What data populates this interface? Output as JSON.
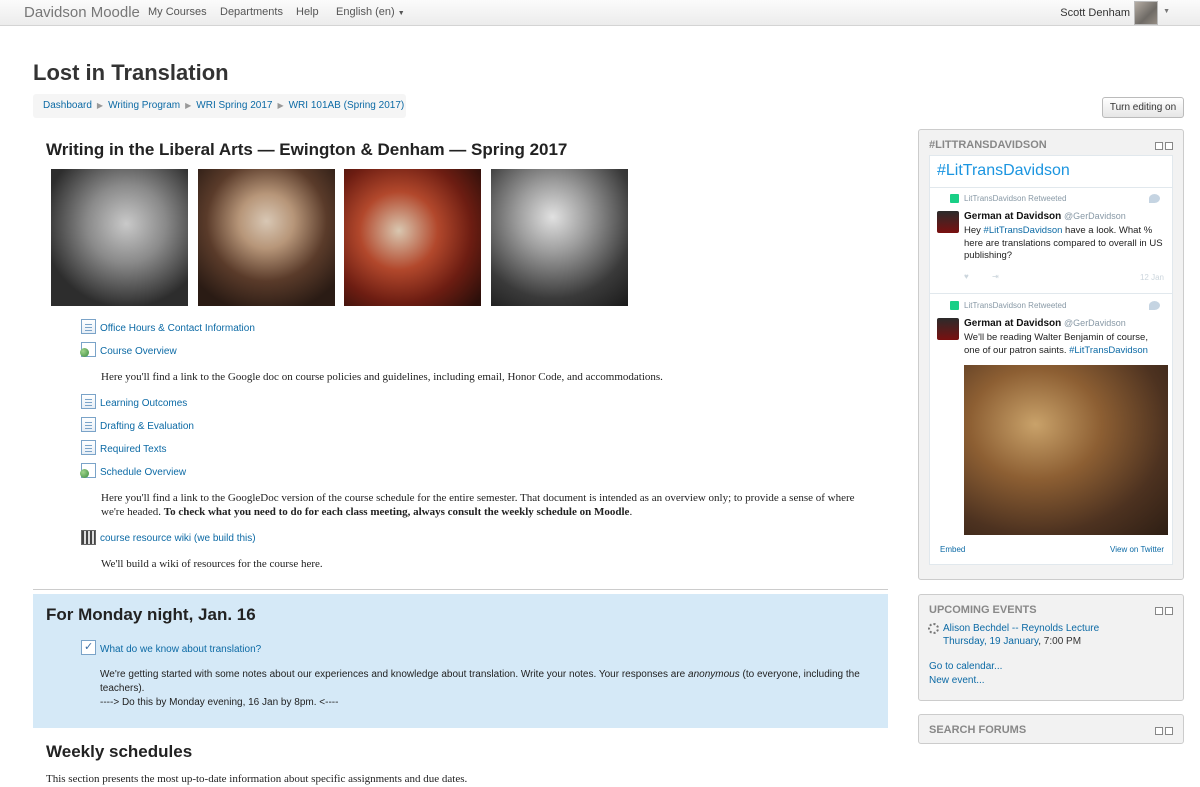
{
  "navbar": {
    "brand": "Davidson Moodle",
    "items": [
      "My Courses",
      "Departments",
      "Help",
      "English (en)"
    ],
    "user_name": "Scott Denham"
  },
  "header": {
    "title": "Lost in Translation",
    "breadcrumb": [
      "Dashboard",
      "Writing Program",
      "WRI Spring 2017",
      "WRI 101AB (Spring 2017)"
    ],
    "edit_button": "Turn editing on"
  },
  "section1": {
    "title": "Writing in the Liberal Arts — Ewington & Denham — Spring 2017",
    "activities": [
      {
        "label": "Office Hours & Contact Information",
        "icon": "document-icon"
      },
      {
        "label": "Course Overview",
        "icon": "url-icon",
        "description": "Here you'll find a link to the Google doc on course policies and guidelines, including email, Honor Code, and accommodations."
      },
      {
        "label": "Learning Outcomes",
        "icon": "document-icon"
      },
      {
        "label": "Drafting & Evaluation",
        "icon": "document-icon"
      },
      {
        "label": "Required Texts",
        "icon": "document-icon"
      },
      {
        "label": "Schedule Overview",
        "icon": "url-icon",
        "description_1": "Here you'll find a link to the GoogleDoc version of the course schedule for the entire semester. That document is intended as an overview only; to provide a sense of where",
        "description_2": "we're headed.",
        "description_bold": "To check what you need to do for each class meeting, always consult the weekly schedule on Moodle"
      },
      {
        "label": "course resource wiki (we build this)",
        "icon": "wiki-icon",
        "description": "We'll build a wiki of resources for the course here."
      }
    ]
  },
  "section2": {
    "title": "For Monday night, Jan. 16",
    "activity_label": "What do we know about translation?",
    "text_1_before": "We're getting started with some notes about our experiences and knowledge about translation. Write your notes. Your responses are",
    "text_1_em": "anonymous",
    "text_1_after": "(to everyone, including the",
    "text_2": "teachers).",
    "text_3": "----> Do this by Monday evening, 16 Jan by 8pm. <----"
  },
  "section3": {
    "title": "Weekly schedules",
    "text": "This section presents the most up-to-date information about specific assignments and due dates."
  },
  "sidebar": {
    "twitter": {
      "block_title": "#LITTRANSDAVIDSON",
      "heading": "#LitTransDavidson",
      "tweets": [
        {
          "retweet": "LitTransDavidson Retweeted",
          "name": "German at Davidson",
          "handle": "@GerDavidson",
          "text_before": "Hey",
          "hashtag": "#LitTransDavidson",
          "text_after": "have a look. What %",
          "line2": "here are translations compared to overall in US",
          "line3": "publishing?",
          "date": "12 Jan"
        },
        {
          "retweet": "LitTransDavidson Retweeted",
          "name": "German at Davidson",
          "handle": "@GerDavidson",
          "line1": "We'll be reading Walter Benjamin of course,",
          "line2_before": "one of our patron saints.",
          "hashtag": "#LitTransDavidson"
        }
      ],
      "embed": "Embed",
      "view": "View on Twitter"
    },
    "events": {
      "block_title": "UPCOMING EVENTS",
      "event_title": "Alison Bechdel -- Reynolds Lecture",
      "event_date_link": "Thursday, 19 January",
      "event_time": ", 7:00 PM",
      "calendar_link": "Go to calendar...",
      "new_event_link": "New event..."
    },
    "search": {
      "block_title": "SEARCH FORUMS"
    }
  },
  "colors": {
    "link": "#0c6aa5",
    "section_highlight": "#d5e9f7",
    "twitter_blue": "#1b95e0",
    "retweet_green": "#19cf86"
  }
}
